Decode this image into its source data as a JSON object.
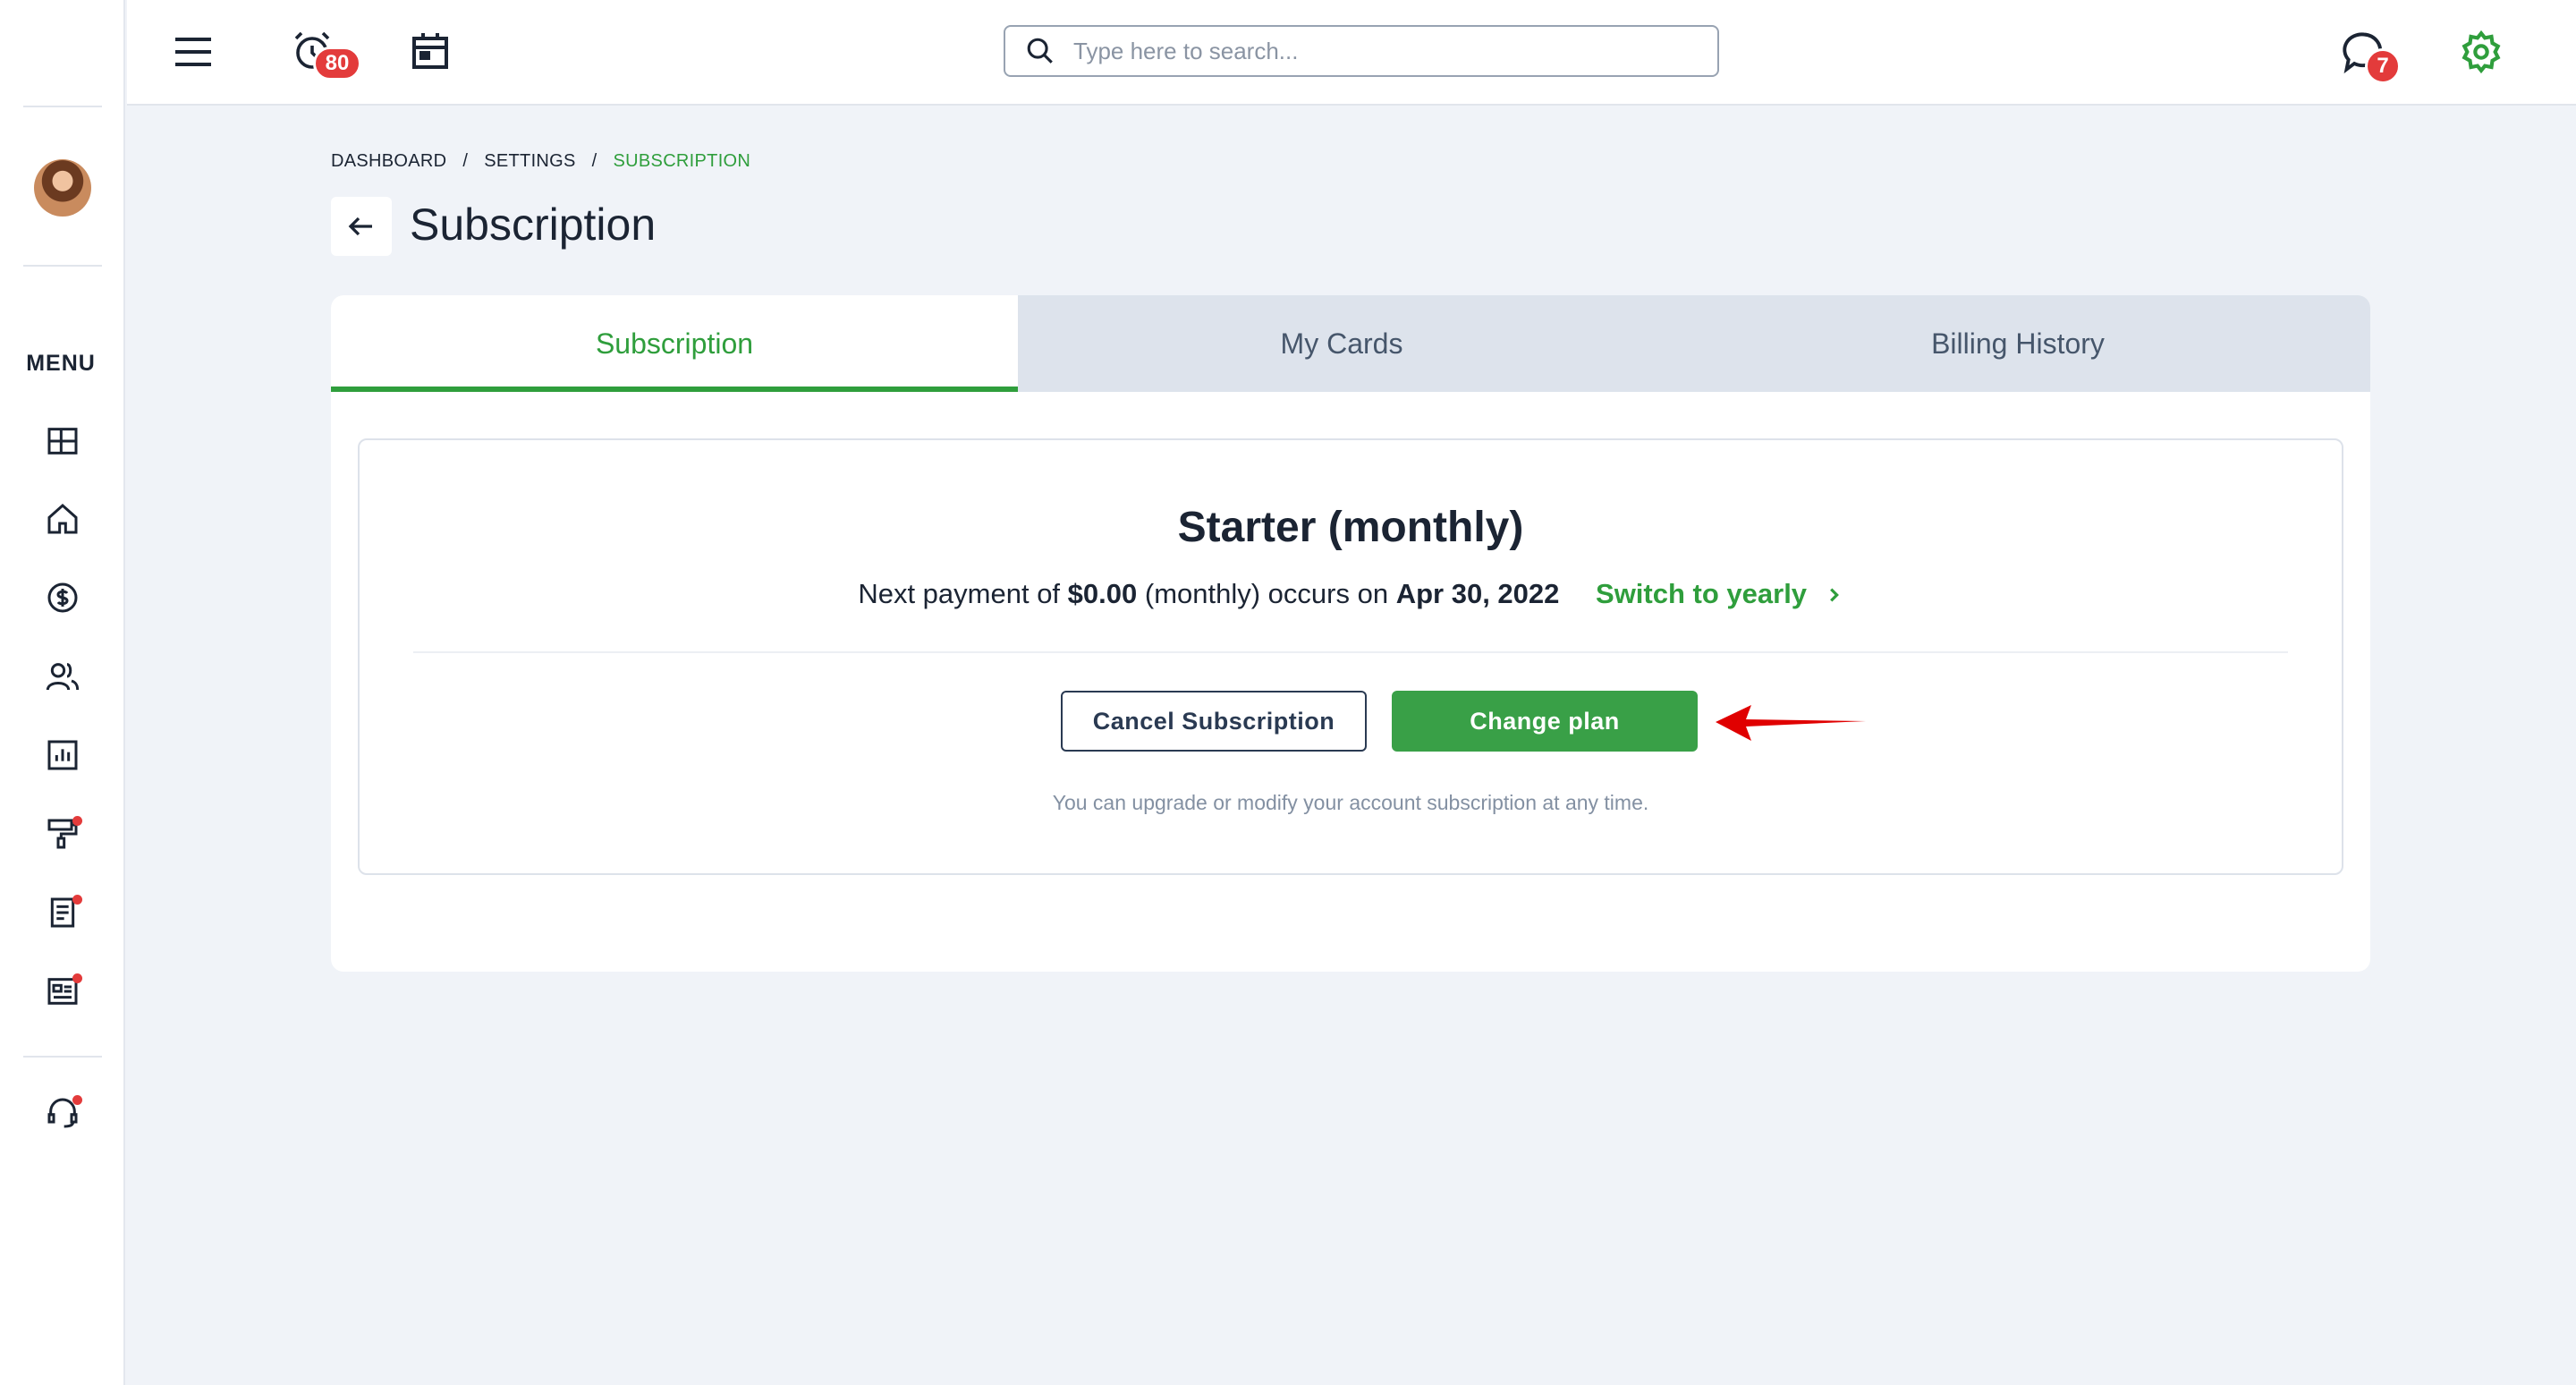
{
  "sidebar": {
    "menu_label": "MENU",
    "items": [
      {
        "name": "dashboard-icon"
      },
      {
        "name": "home-icon"
      },
      {
        "name": "dollar-icon"
      },
      {
        "name": "users-icon"
      },
      {
        "name": "reports-icon"
      },
      {
        "name": "paint-roller-icon",
        "has_dot": true
      },
      {
        "name": "document-icon",
        "has_dot": true
      },
      {
        "name": "news-icon",
        "has_dot": true
      }
    ],
    "support": {
      "name": "headset-icon",
      "has_dot": true
    }
  },
  "topbar": {
    "alarm_badge": "80",
    "chat_badge": "7",
    "search_placeholder": "Type here to search..."
  },
  "breadcrumb": {
    "items": [
      "DASHBOARD",
      "SETTINGS",
      "SUBSCRIPTION"
    ],
    "separator": "/"
  },
  "page": {
    "title": "Subscription"
  },
  "tabs": [
    {
      "label": "Subscription",
      "active": true
    },
    {
      "label": "My Cards",
      "active": false
    },
    {
      "label": "Billing History",
      "active": false
    }
  ],
  "subscription": {
    "plan_name": "Starter (monthly)",
    "payment_prefix": "Next payment of",
    "amount": "$0.00",
    "payment_middle": "(monthly) occurs on",
    "date": "Apr 30, 2022",
    "switch_label": "Switch to yearly",
    "cancel_label": "Cancel Subscription",
    "change_label": "Change plan",
    "note": "You can upgrade or modify your account subscription at any time."
  },
  "colors": {
    "accent": "#2f9e3c",
    "badge": "#e33b3b",
    "annotation_arrow": "#e00000"
  }
}
